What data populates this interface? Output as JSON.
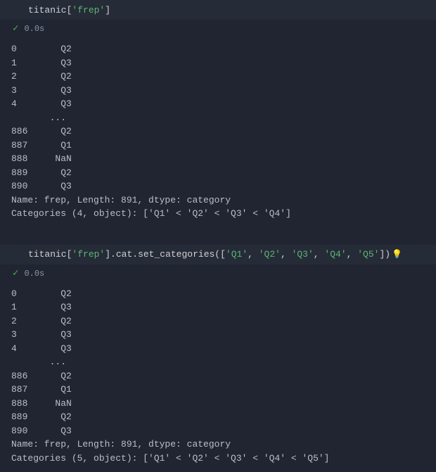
{
  "cells": [
    {
      "code_tokens": [
        {
          "cls": "tok-ident",
          "t": "titanic"
        },
        {
          "cls": "tok-bracket",
          "t": "["
        },
        {
          "cls": "tok-str",
          "t": "'frep'"
        },
        {
          "cls": "tok-bracket",
          "t": "]"
        }
      ],
      "bulb": false,
      "exec_time": "0.0s",
      "output": "0        Q2\n1        Q3\n2        Q2\n3        Q3\n4        Q3\n       ... \n886      Q2\n887      Q1\n888     NaN\n889      Q2\n890      Q3\nName: frep, Length: 891, dtype: category\nCategories (4, object): ['Q1' < 'Q2' < 'Q3' < 'Q4']"
    },
    {
      "code_tokens": [
        {
          "cls": "tok-ident",
          "t": "titanic"
        },
        {
          "cls": "tok-bracket",
          "t": "["
        },
        {
          "cls": "tok-str",
          "t": "'frep'"
        },
        {
          "cls": "tok-bracket",
          "t": "]"
        },
        {
          "cls": "tok-dot",
          "t": "."
        },
        {
          "cls": "tok-ident",
          "t": "cat"
        },
        {
          "cls": "tok-dot",
          "t": "."
        },
        {
          "cls": "tok-ident",
          "t": "set_categories"
        },
        {
          "cls": "tok-bracket",
          "t": "("
        },
        {
          "cls": "tok-bracket",
          "t": "["
        },
        {
          "cls": "tok-str",
          "t": "'Q1'"
        },
        {
          "cls": "tok-punct",
          "t": ", "
        },
        {
          "cls": "tok-str",
          "t": "'Q2'"
        },
        {
          "cls": "tok-punct",
          "t": ", "
        },
        {
          "cls": "tok-str",
          "t": "'Q3'"
        },
        {
          "cls": "tok-punct",
          "t": ", "
        },
        {
          "cls": "tok-str",
          "t": "'Q4'"
        },
        {
          "cls": "tok-punct",
          "t": ", "
        },
        {
          "cls": "tok-str",
          "t": "'Q5'"
        },
        {
          "cls": "tok-bracket",
          "t": "]"
        },
        {
          "cls": "tok-bracket",
          "t": ")"
        }
      ],
      "bulb": true,
      "exec_time": "0.0s",
      "output": "0        Q2\n1        Q3\n2        Q2\n3        Q3\n4        Q3\n       ... \n886      Q2\n887      Q1\n888     NaN\n889      Q2\n890      Q3\nName: frep, Length: 891, dtype: category\nCategories (5, object): ['Q1' < 'Q2' < 'Q3' < 'Q4' < 'Q5']"
    }
  ]
}
